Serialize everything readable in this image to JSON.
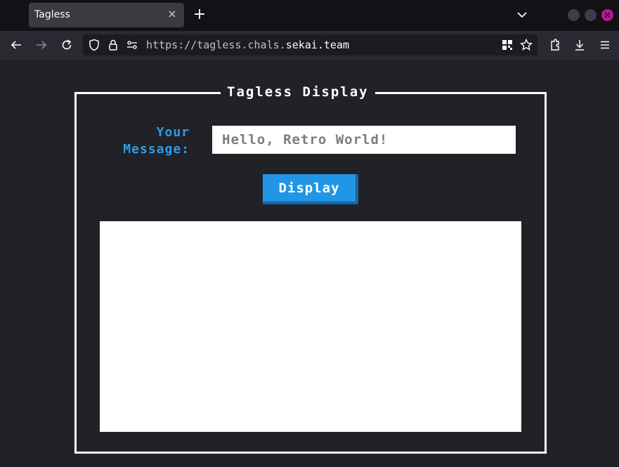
{
  "browser": {
    "tab_title": "Tagless",
    "tab_close_glyph": "×",
    "new_tab_glyph": "+",
    "url_prefix": "https://tagless.chals.",
    "url_domain": "sekai.team"
  },
  "app": {
    "title": "Tagless Display",
    "message_label_line1": "Your",
    "message_label_line2": "Message:",
    "input_placeholder": "Hello, Retro World!",
    "input_value": "",
    "button_label": "Display"
  },
  "colors": {
    "page_bg": "#202228",
    "accent": "#2196e6",
    "label": "#2f9be6",
    "close_button": "#c2149b"
  }
}
